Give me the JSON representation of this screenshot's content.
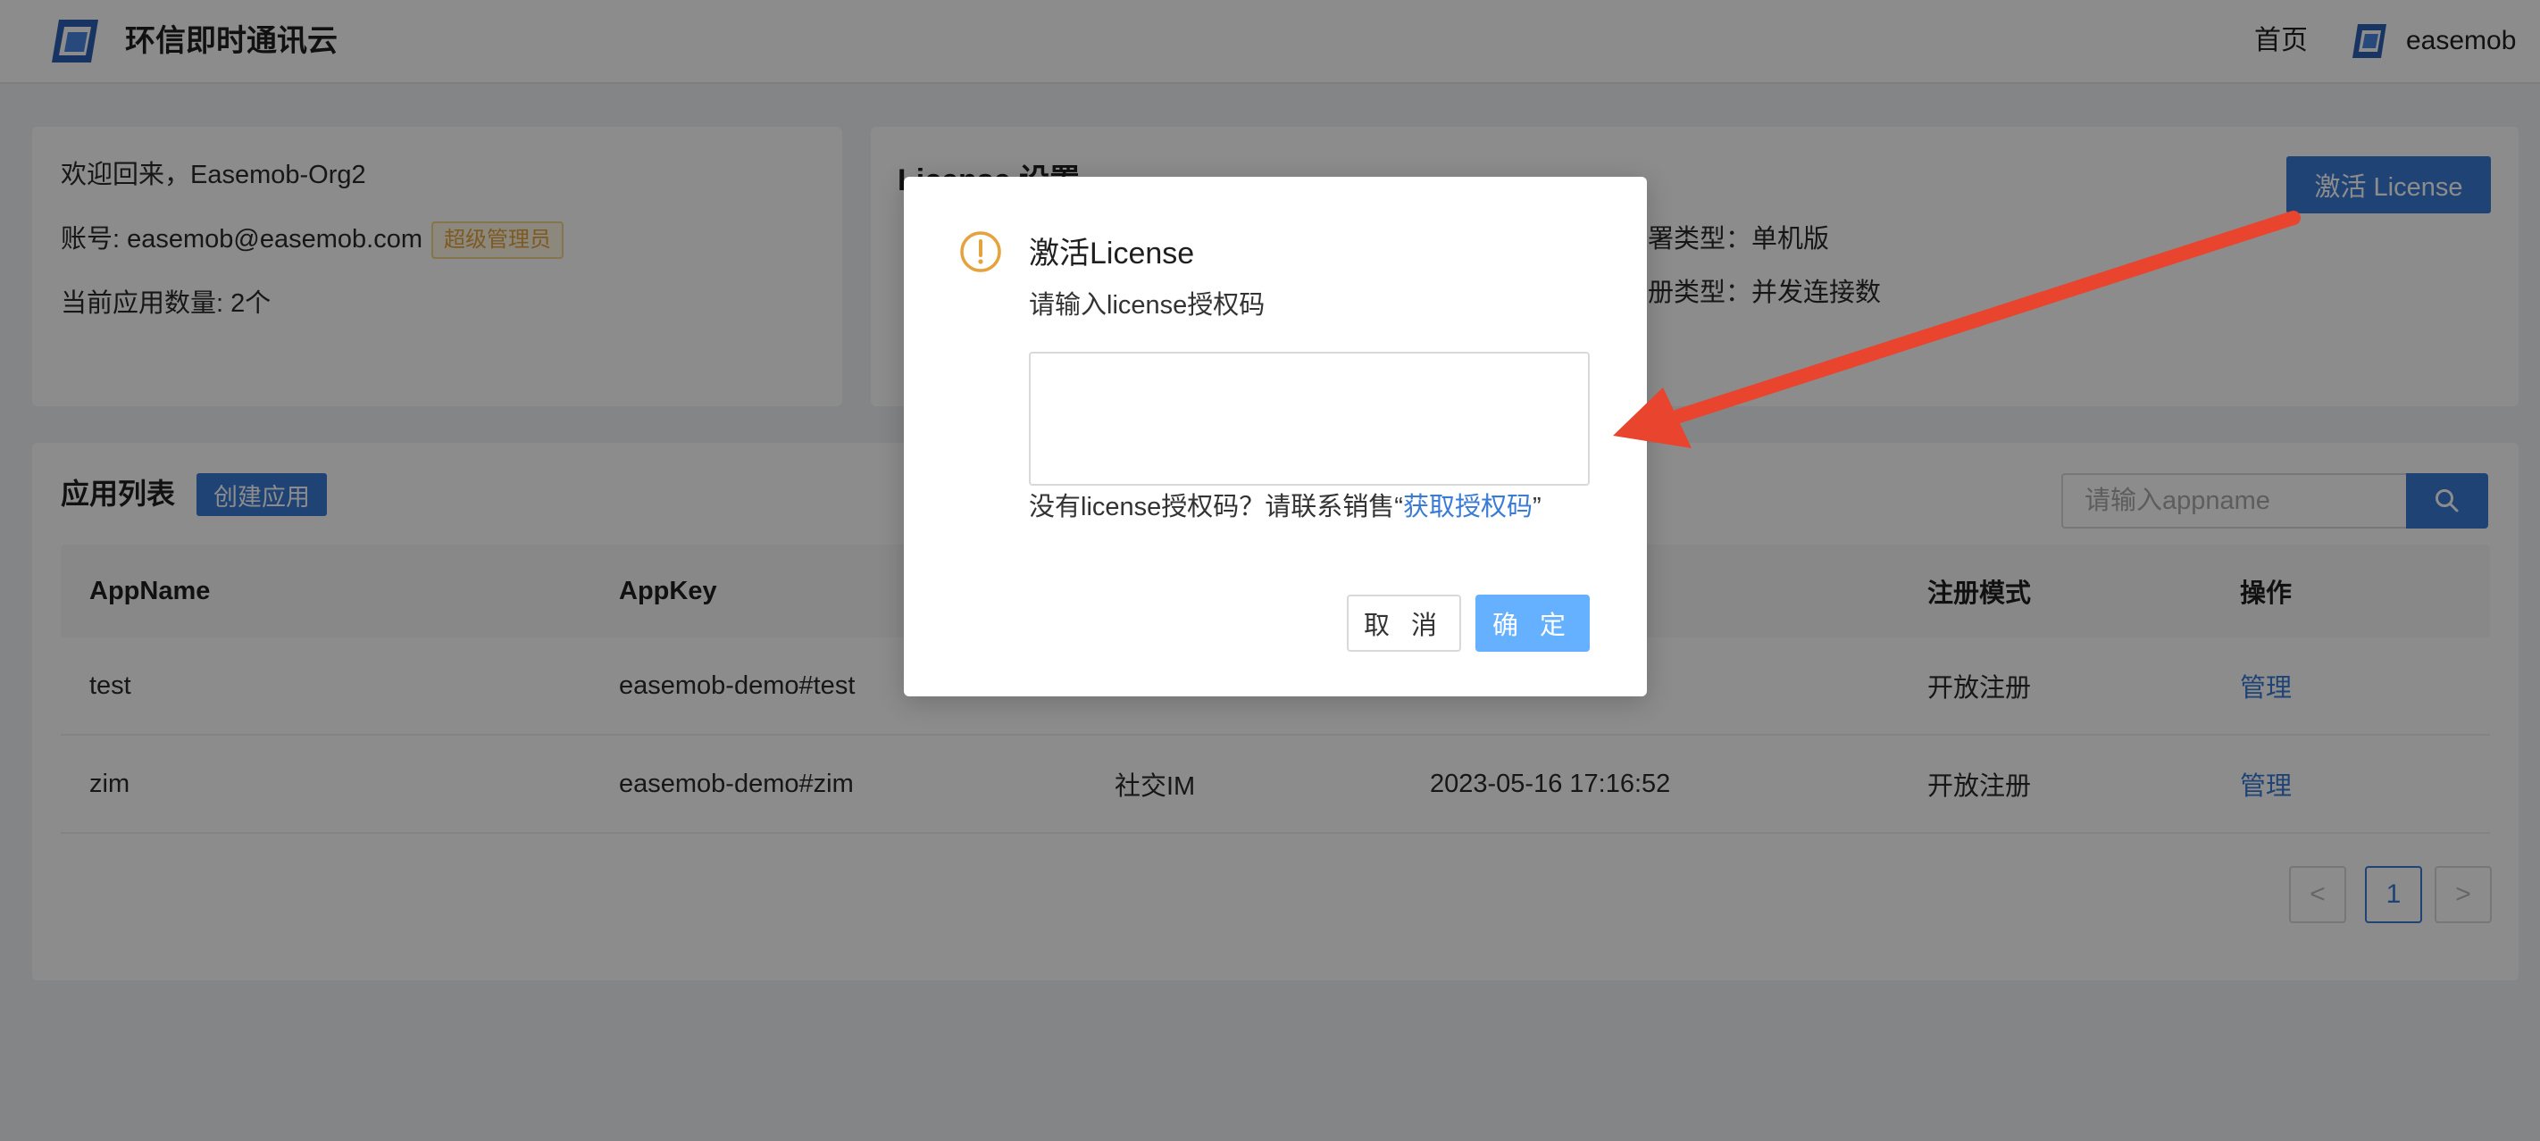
{
  "header": {
    "brand": "环信即时通讯云",
    "nav_home": "首页",
    "user": "easemob"
  },
  "welcome": {
    "greeting": "欢迎回来，Easemob-Org2",
    "account": "账号: easemob@easemob.com",
    "role_badge": "超级管理员",
    "app_count": "当前应用数量: 2个"
  },
  "license": {
    "title": "License 设置",
    "deploy_type": "署类型：单机版",
    "register_type": "册类型：并发连接数",
    "activate_button": "激活 License"
  },
  "apps": {
    "title": "应用列表",
    "create_button": "创建应用",
    "search_placeholder": "请输入appname",
    "columns": [
      "AppName",
      "AppKey",
      "",
      "",
      "注册模式",
      "操作"
    ],
    "rows": [
      {
        "name": "test",
        "key": "easemob-demo#test",
        "type": "",
        "created": "",
        "mode": "开放注册",
        "action": "管理"
      },
      {
        "name": "zim",
        "key": "easemob-demo#zim",
        "type": "社交IM",
        "created": "2023-05-16 17:16:52",
        "mode": "开放注册",
        "action": "管理"
      }
    ],
    "pagination": {
      "prev": "<",
      "page": "1",
      "next": ">"
    }
  },
  "modal": {
    "title": "激活License",
    "prompt": "请输入license授权码",
    "hint_prefix": "没有license授权码？请联系销售“",
    "hint_link": "获取授权码",
    "hint_suffix": "”",
    "cancel": "取 消",
    "ok": "确 定",
    "icon": "warning-circle-icon"
  },
  "colors": {
    "primary": "#3a7bd5",
    "warning": "#e6a23c",
    "annotation_arrow": "#e8442e"
  }
}
